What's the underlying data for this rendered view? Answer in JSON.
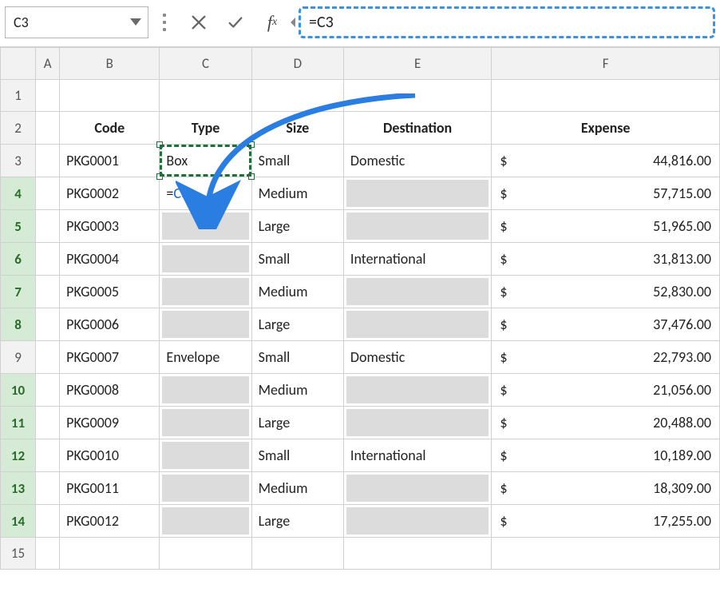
{
  "formula_bar": {
    "name_box": "C3",
    "formula": "=C3"
  },
  "columns": [
    "A",
    "B",
    "C",
    "D",
    "E",
    "F"
  ],
  "headers": {
    "B": "Code",
    "C": "Type",
    "D": "Size",
    "E": "Destination",
    "F": "Expense"
  },
  "rows": [
    {
      "n": 1
    },
    {
      "n": 2,
      "header": true
    },
    {
      "n": 3,
      "B": "PKG0001",
      "C": "Box",
      "D": "Small",
      "E": "Domestic",
      "F_amt": "44,816.00"
    },
    {
      "n": 4,
      "B": "PKG0002",
      "C_formula": "=C3",
      "D": "Medium",
      "E_blank": true,
      "F_amt": "57,715.00",
      "editing": true
    },
    {
      "n": 5,
      "B": "PKG0003",
      "C_blank": true,
      "D": "Large",
      "E_blank": true,
      "F_amt": "51,965.00"
    },
    {
      "n": 6,
      "B": "PKG0004",
      "C_blank": true,
      "D": "Small",
      "E": "International",
      "F_amt": "31,813.00"
    },
    {
      "n": 7,
      "B": "PKG0005",
      "C_blank": true,
      "D": "Medium",
      "E_blank": true,
      "F_amt": "52,830.00"
    },
    {
      "n": 8,
      "B": "PKG0006",
      "C_blank": true,
      "D": "Large",
      "E_blank": true,
      "F_amt": "37,476.00"
    },
    {
      "n": 9,
      "B": "PKG0007",
      "C": "Envelope",
      "D": "Small",
      "E": "Domestic",
      "F_amt": "22,793.00"
    },
    {
      "n": 10,
      "B": "PKG0008",
      "C_blank": true,
      "D": "Medium",
      "E_blank": true,
      "F_amt": "21,056.00"
    },
    {
      "n": 11,
      "B": "PKG0009",
      "C_blank": true,
      "D": "Large",
      "E_blank": true,
      "F_amt": "20,488.00"
    },
    {
      "n": 12,
      "B": "PKG0010",
      "C_blank": true,
      "D": "Small",
      "E": "International",
      "F_amt": "10,189.00"
    },
    {
      "n": 13,
      "B": "PKG0011",
      "C_blank": true,
      "D": "Medium",
      "E_blank": true,
      "F_amt": "18,309.00"
    },
    {
      "n": 14,
      "B": "PKG0012",
      "C_blank": true,
      "D": "Large",
      "E_blank": true,
      "F_amt": "17,255.00"
    },
    {
      "n": 15
    }
  ],
  "currency_symbol": "$",
  "active_cell": "C4",
  "reference_cell": "C3",
  "highlighted_row_headers": [
    4,
    5,
    6,
    7,
    8,
    10,
    11,
    12,
    13,
    14
  ]
}
